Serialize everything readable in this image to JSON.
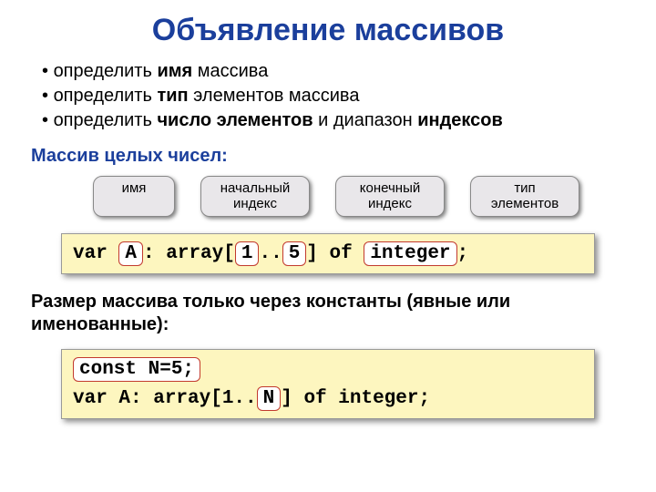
{
  "title": "Объявление массивов",
  "bullets": {
    "b1a": "определить ",
    "b1b": "имя",
    "b1c": " массива",
    "b2a": "определить ",
    "b2b": "тип",
    "b2c": " элементов массива",
    "b3a": "определить ",
    "b3b": "число элементов",
    "b3c": " и диапазон ",
    "b3d": "индексов"
  },
  "sub1": "Массив целых чисел:",
  "pills": {
    "p1": "имя",
    "p2": "начальный индекс",
    "p3": "конечный индекс",
    "p4": "тип элементов"
  },
  "code1": {
    "t1": "var ",
    "c1": "A",
    "t2": ": array[",
    "c2": "1",
    "t3": "..",
    "c3": "5",
    "t4": "] of ",
    "c4": "integer",
    "t5": ";"
  },
  "sub2": "Размер массива только через константы (явные или именованные):",
  "code2": {
    "line1": "const N=5;",
    "t1": "var A: array[1..",
    "c1": "N",
    "t2": "] of integer;"
  }
}
